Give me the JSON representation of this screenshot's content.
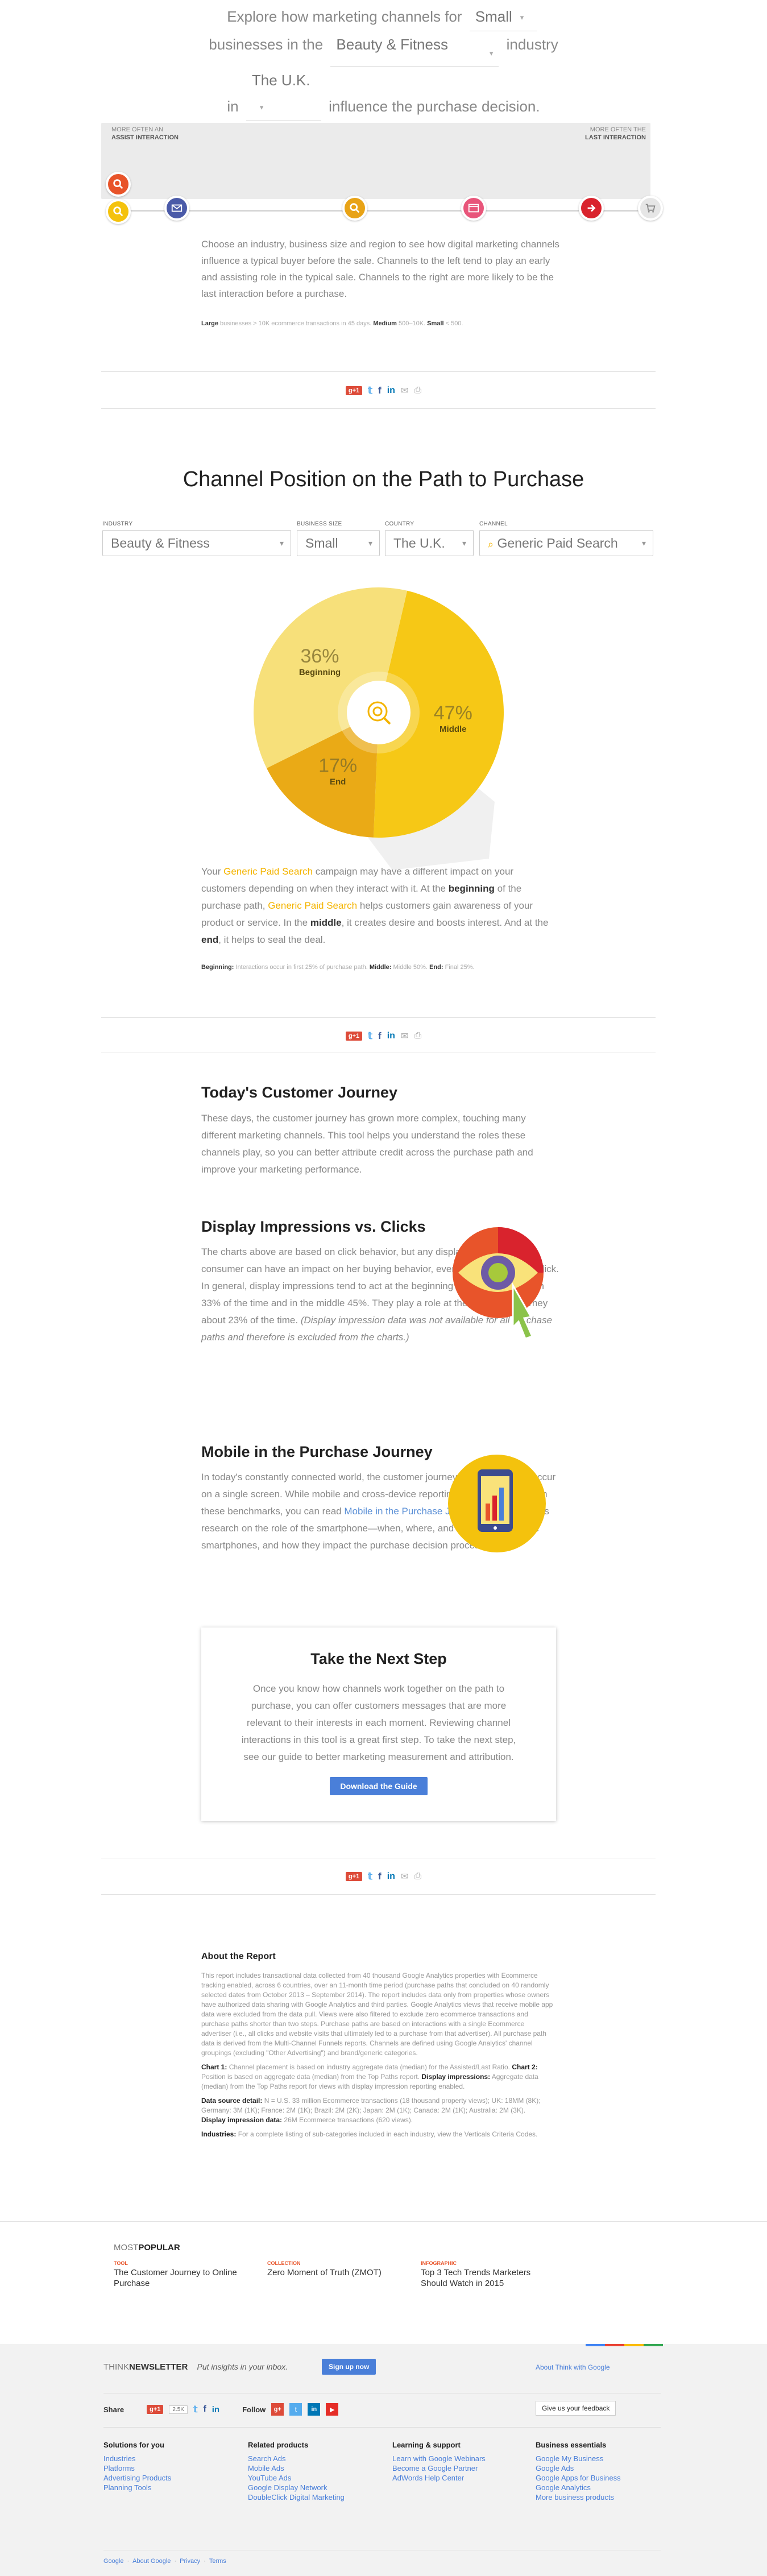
{
  "headline": {
    "part1": "Explore how marketing channels for",
    "size": "Small",
    "part2": "businesses in the",
    "industry": "Beauty & Fitness",
    "part3": "industry",
    "part4": "in",
    "region": "The U.K.",
    "part5": "influence the purchase decision."
  },
  "path": {
    "left_top": "More often an",
    "left_bottom": "Assist Interaction",
    "right_top": "More often the",
    "right_bottom": "Last Interaction"
  },
  "intro": {
    "text": "Choose an industry, business size and region to see how digital marketing channels influence a typical buyer before the sale. Channels to the left tend to play an early and assisting role in the typical sale. Channels to the right are more likely to be the last interaction before a purchase.",
    "legend_large_label": "Large",
    "legend_large_text": "businesses > 10K ecommerce transactions in 45 days.",
    "legend_medium_label": "Medium",
    "legend_medium_text": "500–10K.",
    "legend_small_label": "Small",
    "legend_small_text": "< 500."
  },
  "share": {
    "gplus": "g+1"
  },
  "share_counts": {
    "gplus": "2.5K"
  },
  "channel_section": {
    "title": "Channel Position on the Path to Purchase",
    "industry_label": "Industry",
    "industry_value": "Beauty & Fitness",
    "size_label": "Business Size",
    "size_value": "Small",
    "country_label": "Country",
    "country_value": "The U.K.",
    "channel_label": "Channel",
    "channel_value": "Generic Paid Search"
  },
  "chart_data": {
    "type": "pie",
    "slices": [
      {
        "label": "Beginning",
        "value": 36,
        "display": "36%",
        "color": "#f7e07a"
      },
      {
        "label": "Middle",
        "value": 47,
        "display": "47%",
        "color": "#f6c816"
      },
      {
        "label": "End",
        "value": 17,
        "display": "17%",
        "color": "#eaaa16"
      }
    ]
  },
  "channel_text": {
    "p1": "Your",
    "channel": "Generic Paid Search",
    "p2": "campaign may have a different impact on your customers depending on when they interact with it. At the",
    "beginning": "beginning",
    "p3": "of the purchase path,",
    "p4": "helps customers gain awareness of your product or service. In the",
    "middle": "middle",
    "p5": ", it creates desire and boosts interest. And at the",
    "end": "end",
    "p6": ", it helps to seal the deal."
  },
  "channel_legend": {
    "beginning_label": "Beginning:",
    "beginning_text": "Interactions occur in first 25% of purchase path.",
    "middle_label": "Middle:",
    "middle_text": "Middle 50%.",
    "end_label": "End:",
    "end_text": "Final 25%."
  },
  "journey": {
    "title": "Today's Customer Journey",
    "text": "These days, the customer journey has grown more complex, touching many different marketing channels. This tool helps you understand the roles these channels play, so you can better attribute credit across the purchase path and improve your marketing performance."
  },
  "display": {
    "title": "Display Impressions vs. Clicks",
    "text": "The charts above are based on click behavior, but any display ad seen by a consumer can have an impact on her buying behavior, even when she doesn't click. In general, display impressions tend to act at the beginning of the purchase path 33% of the time and in the middle 45%. They play a role at the end of the journey about 23% of the time.",
    "italic": "(Display impression data was not available for all purchase paths and therefore is excluded from the charts.)"
  },
  "mobile": {
    "title": "Mobile in the Purchase Journey",
    "text1": "In today's constantly connected world, the customer journey does not always occur on a single screen. While mobile and cross-device reporting is not yet included in these benchmarks, you can read",
    "link": "Mobile in the Purchase Journey",
    "text2": "to see Google's research on the role of the smartphone—when, where, and why customers use smartphones, and how they impact the purchase decision process."
  },
  "next_step": {
    "title": "Take the Next Step",
    "text": "Once you know how channels work together on the path to purchase, you can offer customers messages that are more relevant to their interests in each moment. Reviewing channel interactions in this tool is a great first step. To take the next step, see our guide to better marketing measurement and attribution.",
    "button": "Download the Guide"
  },
  "about": {
    "title": "About the Report",
    "text": "This report includes transactional data collected from 40 thousand Google Analytics properties with Ecommerce tracking enabled, across 6 countries, over an 11-month time period (purchase paths that concluded on 40 randomly selected dates from October 2013 – September 2014). The report includes data only from properties whose owners have authorized data sharing with Google Analytics and third parties. Google Analytics views that receive mobile app data were excluded from the data pull. Views were also filtered to exclude zero ecommerce transactions and purchase paths shorter than two steps. Purchase paths are based on interactions with a single Ecommerce advertiser (i.e., all clicks and website visits that ultimately led to a purchase from that advertiser). All purchase path data is derived from the Multi-Channel Funnels reports. Channels are defined using Google Analytics' channel groupings (excluding \"Other Advertising\") and brand/generic categories.",
    "chart1_label": "Chart 1:",
    "chart1_text": "Channel placement is based on industry aggregate data (median) for the Assisted/Last Ratio.",
    "chart2_label": "Chart 2:",
    "chart2_text": "Position is based on aggregate data (median) from the Top Paths report.",
    "disp_label": "Display impressions:",
    "disp_text": "Aggregate data (median) from the Top Paths report for views with display impression reporting enabled.",
    "source_label": "Data source detail:",
    "source_text": "N = U.S. 33 million Ecommerce transactions (18 thousand property views); UK: 18MM (8K); Germany: 3M (1K); France: 2M (1K); Brazil: 2M (2K); Japan: 2M (1K); Canada: 2M (1K); Australia: 2M (3K).",
    "dispdata_label": "Display impression data:",
    "dispdata_text": "26M Ecommerce transactions (620 views).",
    "industries_label": "Industries:",
    "industries_text": "For a complete listing of sub-categories included in each industry, view the Verticals Criteria Codes."
  },
  "most_popular": {
    "title_a": "MOST",
    "title_b": "POPULAR",
    "items": [
      {
        "tag": "TOOL",
        "title": "The Customer Journey to Online Purchase"
      },
      {
        "tag": "COLLECTION",
        "title": "Zero Moment of Truth (ZMOT)"
      },
      {
        "tag": "INFOGRAPHIC",
        "title": "Top 3 Tech Trends Marketers Should Watch in 2015"
      }
    ]
  },
  "footer": {
    "newsletter_a": "THINK",
    "newsletter_b": "NEWSLETTER",
    "tagline": "Put insights in your inbox.",
    "signup": "Sign up now",
    "about_link": "About Think with Google",
    "share_label": "Share",
    "follow_label": "Follow",
    "feedback": "Give us your feedback",
    "columns": [
      {
        "title": "Solutions for you",
        "links": [
          "Industries",
          "Platforms",
          "Advertising Products",
          "Planning Tools"
        ]
      },
      {
        "title": "Related products",
        "links": [
          "Search Ads",
          "Mobile Ads",
          "YouTube Ads",
          "Google Display Network",
          "DoubleClick Digital Marketing"
        ]
      },
      {
        "title": "Learning & support",
        "links": [
          "Learn with Google Webinars",
          "Become a Google Partner",
          "AdWords Help Center"
        ]
      },
      {
        "title": "Business essentials",
        "links": [
          "Google My Business",
          "Google Ads",
          "Google Apps for Business",
          "Google Analytics",
          "More business products"
        ]
      }
    ],
    "bottom_links": [
      "Google",
      "About Google",
      "Privacy",
      "Terms"
    ]
  }
}
